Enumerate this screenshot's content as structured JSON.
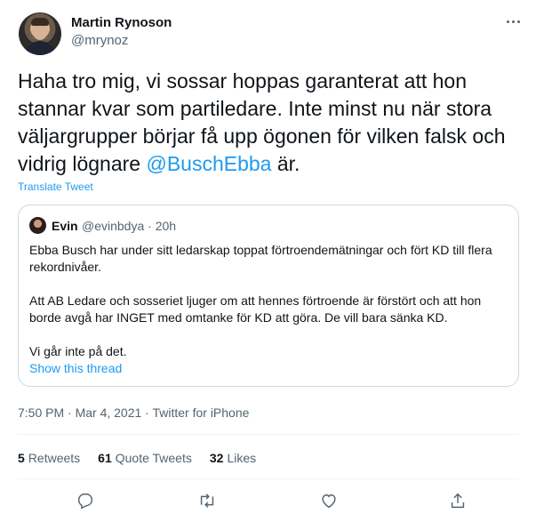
{
  "author": {
    "name": "Martin Rynoson",
    "handle": "@mrynoz"
  },
  "tweet": {
    "text_pre": "Haha tro mig, vi sossar hoppas garanterat att hon stannar kvar som partiledare. Inte minst nu när stora väljargrupper börjar få upp ögonen för vilken falsk och vidrig lögnare ",
    "mention": "@BuschEbba",
    "text_post": " är.",
    "translate_label": "Translate Tweet"
  },
  "quote": {
    "name": "Evin",
    "meta": "@evinbdya · 20h",
    "paragraphs": [
      "Ebba Busch har under sitt ledarskap toppat förtroendemätningar och fört KD till flera rekordnivåer.",
      "Att AB Ledare och sosseriet ljuger om att hennes förtroende är förstört och att hon borde avgå har INGET med omtanke för KD att göra. De vill bara sänka KD.",
      "Vi går inte på det."
    ],
    "show_thread": "Show this thread"
  },
  "meta": {
    "timestamp": "7:50 PM · Mar 4, 2021 · Twitter for iPhone"
  },
  "stats": {
    "retweets_count": "5",
    "retweets_label": "Retweets",
    "quotes_count": "61",
    "quotes_label": "Quote Tweets",
    "likes_count": "32",
    "likes_label": "Likes"
  },
  "icons": {
    "reply": "reply-icon",
    "retweet": "retweet-icon",
    "like": "heart-icon",
    "share": "share-icon",
    "more": "more-icon"
  },
  "colors": {
    "link": "#1d9bf0",
    "secondary": "#536471",
    "text": "#0f1419",
    "border": "#cfd9de"
  }
}
